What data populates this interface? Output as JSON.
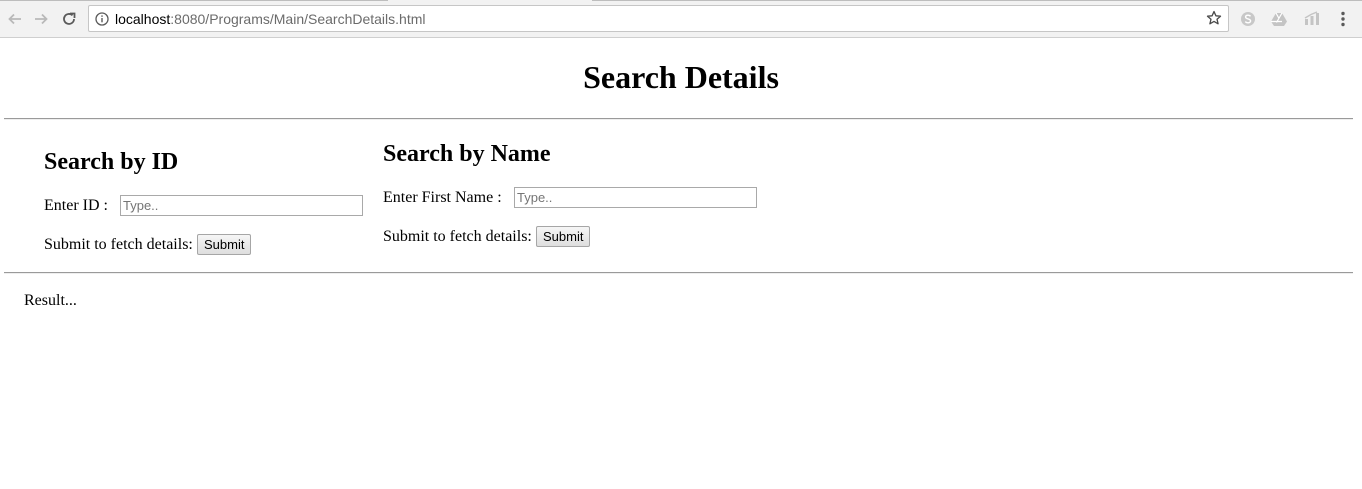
{
  "browser": {
    "url_host": "localhost",
    "url_rest": ":8080/Programs/Main/SearchDetails.html",
    "icons": {
      "back": "back-arrow-icon",
      "forward": "forward-arrow-icon",
      "reload": "reload-icon",
      "info": "info-icon",
      "bookmark": "star-icon",
      "extensions": [
        "skype-icon",
        "drive-icon",
        "analytics-icon"
      ],
      "menu": "kebab-menu-icon"
    }
  },
  "page": {
    "title": "Search Details",
    "search_by_id": {
      "heading": "Search by ID",
      "id_label": "Enter ID :",
      "id_placeholder": "Type..",
      "id_value": "",
      "submit_label": "Submit to fetch details:",
      "submit_button": "Submit"
    },
    "search_by_name": {
      "heading": "Search by Name",
      "name_label": "Enter First Name :",
      "name_placeholder": "Type..",
      "name_value": "",
      "submit_label": "Submit to fetch details:",
      "submit_button": "Submit"
    },
    "result_text": "Result..."
  }
}
